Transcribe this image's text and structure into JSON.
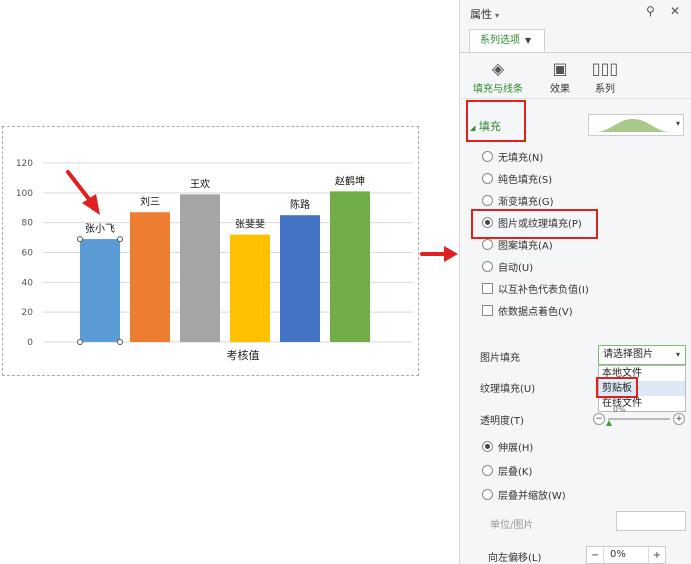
{
  "chart_data": {
    "type": "bar",
    "categories": [
      "张小飞",
      "刘三",
      "王欢",
      "张斐斐",
      "陈路",
      "赵鹤坤"
    ],
    "values": [
      69,
      87,
      99,
      72,
      85,
      101
    ],
    "colors": [
      "#5b9bd5",
      "#ed7d31",
      "#a5a5a5",
      "#ffc000",
      "#4472c4",
      "#70ad47"
    ],
    "xlabel": "考核值",
    "ylim": [
      0,
      120
    ],
    "yticks": [
      0,
      20,
      40,
      60,
      80,
      100,
      120
    ],
    "grid": true,
    "legend": "none"
  },
  "panel": {
    "title": "属性",
    "tab_series": "系列选项",
    "subtabs": [
      {
        "label": "填充与线条",
        "icon": "fill-bucket-icon"
      },
      {
        "label": "效果",
        "icon": "effects-icon"
      },
      {
        "label": "系列",
        "icon": "series-icon"
      }
    ],
    "fill_section": "填充",
    "fill_options": [
      {
        "label": "无填充(N)",
        "checked": false
      },
      {
        "label": "纯色填充(S)",
        "checked": false
      },
      {
        "label": "渐变填充(G)",
        "checked": false
      },
      {
        "label": "图片或纹理填充(P)",
        "checked": true
      },
      {
        "label": "图案填充(A)",
        "checked": false
      },
      {
        "label": "自动(U)",
        "checked": false
      }
    ],
    "checkbox_options": [
      "以互补色代表负值(I)",
      "依数据点着色(V)"
    ],
    "picture_fill_label": "图片填充",
    "picture_fill_value": "请选择图片",
    "dropdown_items": [
      "本地文件",
      "剪贴板",
      "在线文件"
    ],
    "texture_fill_label": "纹理填充(U)",
    "transparency_label": "透明度(T)",
    "transparency_value": "0%",
    "stretch_options": [
      {
        "label": "伸展(H)",
        "checked": true
      },
      {
        "label": "层叠(K)",
        "checked": false
      },
      {
        "label": "层叠并缩放(W)",
        "checked": false
      }
    ],
    "unit_label": "单位/图片",
    "offset_left_label": "向左偏移(L)",
    "offset_left_value": "0%",
    "stepper_minus": "−",
    "stepper_plus": "+"
  },
  "annotation_color": "#e02020"
}
